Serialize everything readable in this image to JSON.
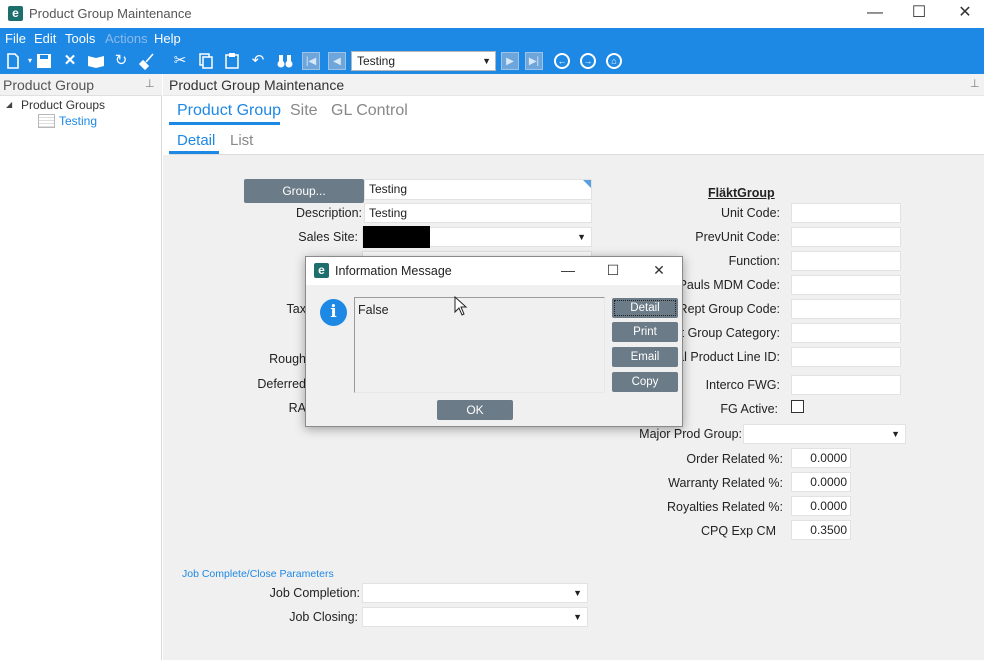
{
  "window": {
    "logo_letter": "e",
    "title": "Product Group Maintenance",
    "minimize": "—",
    "maximize": "☐",
    "close": "✕"
  },
  "menu": {
    "file": "File",
    "edit": "Edit",
    "tools": "Tools",
    "actions": "Actions",
    "help": "Help"
  },
  "toolbar": {
    "record_value": "Testing"
  },
  "left_pane": {
    "title": "Product Group",
    "tree_root": "Product Groups",
    "tree_child": "Testing"
  },
  "main": {
    "title": "Product Group Maintenance",
    "tabs": [
      {
        "label": "Product Group"
      },
      {
        "label": "Site"
      },
      {
        "label": "GL Control"
      }
    ],
    "subtabs": [
      {
        "label": "Detail"
      },
      {
        "label": "List"
      }
    ]
  },
  "form": {
    "group_button": "Group...",
    "group_value": "Testing",
    "description_label": "Description:",
    "description_value": "Testing",
    "sales_site_label": "Sales Site:",
    "tax_label_partial": "Tax",
    "rough_label_partial": "Rough",
    "deferred_label_partial": "Deferred",
    "ra_label_partial": "RA"
  },
  "flakt": {
    "heading": "FläktGroup",
    "unit_code_label": "Unit Code:",
    "prevunit_code_label": "PrevUnit Code:",
    "function_label": "Function:",
    "pauls_mdm_label_partial": "Pauls MDM Code:",
    "rept_group_label_partial": "Rept Group Code:",
    "group_category_label_partial": "t Group Category:",
    "product_line_label_partial": "al Product Line ID:",
    "interco_fwg_label": "Interco FWG:",
    "fg_active_label": "FG Active:",
    "fg_active_checked": false,
    "major_prod_group_label": "Major Prod Group:",
    "order_related_label": "Order Related %:",
    "order_related_value": "0.0000",
    "warranty_related_label": "Warranty Related %:",
    "warranty_related_value": "0.0000",
    "royalties_related_label": "Royalties Related %:",
    "royalties_related_value": "0.0000",
    "cpq_exp_label": "CPQ Exp CM",
    "cpq_exp_value": "0.3500"
  },
  "job": {
    "section_title": "Job Complete/Close Parameters",
    "completion_label": "Job Completion:",
    "closing_label": "Job Closing:"
  },
  "dialog": {
    "logo_letter": "e",
    "title": "Information Message",
    "message": "False",
    "info_icon": "i",
    "detail_button": "Detail",
    "print_button": "Print",
    "email_button": "Email",
    "copy_button": "Copy",
    "ok_button": "OK",
    "minimize": "—",
    "maximize": "☐",
    "close": "✕"
  },
  "colors": {
    "accent": "#1e88e5",
    "button_gray": "#6b7b87",
    "logo_teal": "#1f6e6e"
  }
}
